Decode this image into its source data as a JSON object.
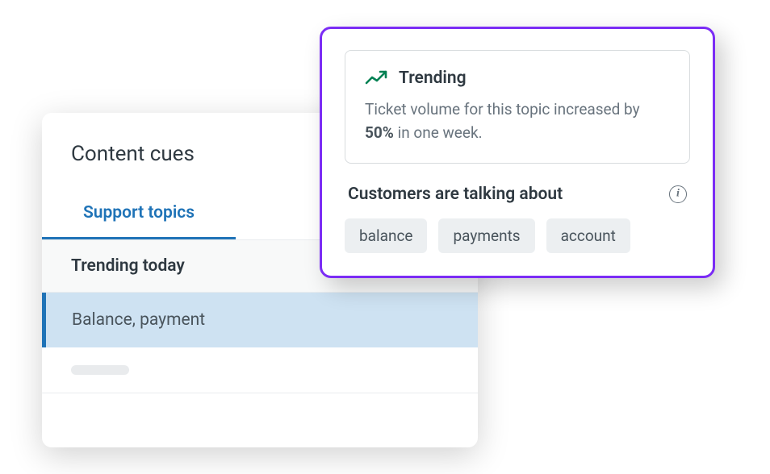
{
  "backCard": {
    "title": "Content cues",
    "tab": "Support topics",
    "sectionHeader": "Trending today",
    "listItem": "Balance, payment"
  },
  "frontCard": {
    "trendingLabel": "Trending",
    "trendingDescPrefix": "Ticket volume for this topic increased by ",
    "trendingPercent": "50%",
    "trendingDescSuffix": " in one week.",
    "talkingTitle": "Customers are talking about",
    "chips": [
      "balance",
      "payments",
      "account"
    ]
  }
}
